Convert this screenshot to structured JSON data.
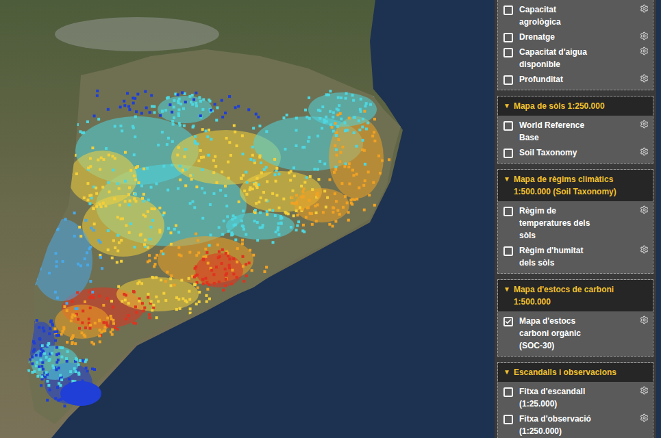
{
  "layers_panel": {
    "sections": [
      {
        "items": [
          {
            "label": "Capacitat agrològica",
            "checked": false
          },
          {
            "label": "Drenatge",
            "checked": false
          },
          {
            "label": "Capacitat d'aigua disponible",
            "checked": false
          },
          {
            "label": "Profunditat",
            "checked": false
          }
        ]
      },
      {
        "toggle": "▼",
        "title": "Mapa de sòls 1:250.000",
        "expanded": true,
        "items": [
          {
            "label": "World Reference Base",
            "checked": false
          },
          {
            "label": "Soil Taxonomy",
            "checked": false
          }
        ]
      },
      {
        "toggle": "▼",
        "title": "Mapa de règims climàtics 1:500.000 (Soil Taxonomy)",
        "expanded": true,
        "items": [
          {
            "label": "Règim de temperatures dels sòls",
            "checked": false
          },
          {
            "label": "Règim d'humitat dels sòls",
            "checked": false
          }
        ]
      },
      {
        "toggle": "▼",
        "title": "Mapa d'estocs de carboni 1:500.000",
        "expanded": true,
        "items": [
          {
            "label": "Mapa d'estocs carboni orgànic (SOC-30)",
            "checked": true
          }
        ]
      },
      {
        "toggle": "▼",
        "title": "Escandalls i observacions",
        "expanded": true,
        "items": [
          {
            "label": "Fitxa d'escandall (1:25.000)",
            "checked": false
          },
          {
            "label": "Fitxa d'observació (1:250.000)",
            "checked": false
          }
        ]
      }
    ]
  }
}
